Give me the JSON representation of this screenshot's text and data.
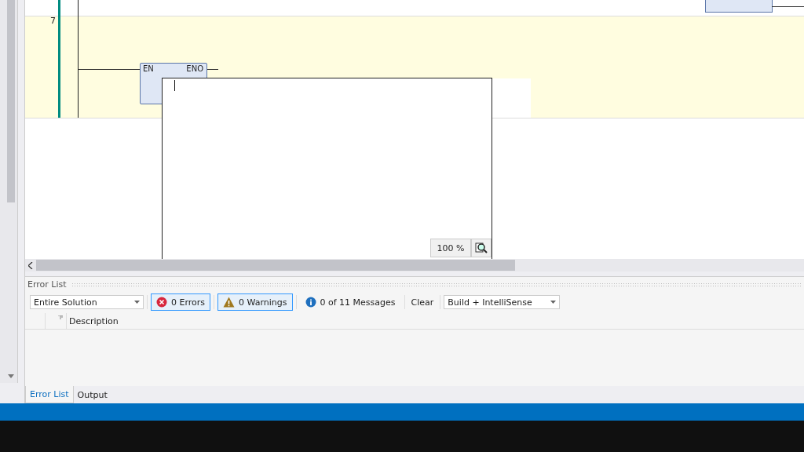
{
  "editor": {
    "rung_number": "7",
    "block": {
      "inputs": [
        "EN"
      ],
      "outputs": [
        "ENO"
      ]
    },
    "zoom": "100 %"
  },
  "error_list": {
    "title": "Error List",
    "scope": "Entire Solution",
    "filters": [
      {
        "kind": "error",
        "label": "0 Errors",
        "selected": true
      },
      {
        "kind": "warning",
        "label": "0 Warnings",
        "selected": true
      },
      {
        "kind": "info",
        "label": "0 of 11 Messages",
        "selected": false
      }
    ],
    "clear": "Clear",
    "source": "Build + IntelliSense",
    "columns": [
      "Description"
    ]
  },
  "tabs": [
    {
      "label": "Error List",
      "selected": true
    },
    {
      "label": "Output",
      "selected": false
    }
  ]
}
